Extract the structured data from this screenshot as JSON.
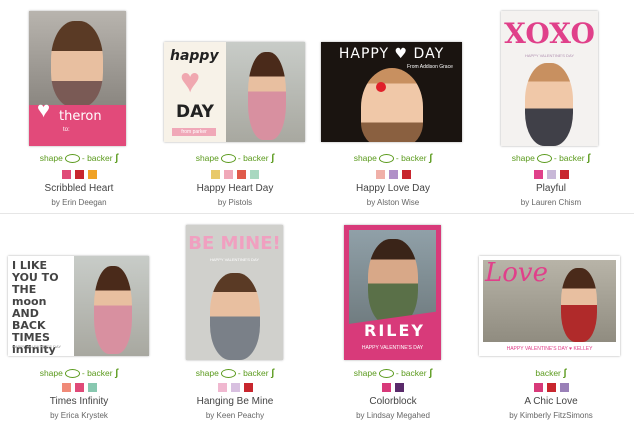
{
  "options_label": {
    "shape": "shape",
    "sep": "-",
    "backer": "backer"
  },
  "cards": [
    {
      "name": "Scribbled Heart",
      "by": "by Erin Deegan",
      "options": "shape_backer",
      "swatches": [
        "#e04a78",
        "#c8262e",
        "#f0a226"
      ],
      "card_text": "theron",
      "card_subtext": "to:"
    },
    {
      "name": "Happy Heart Day",
      "by": "by Pistols",
      "options": "shape_backer",
      "swatches": [
        "#e8c96a",
        "#f0a8b8",
        "#e05a4a",
        "#a8d8c0"
      ],
      "card_text": "happy",
      "card_text2": "DAY",
      "card_subtext": "from parker"
    },
    {
      "name": "Happy Love Day",
      "by": "by Alston Wise",
      "options": "shape_backer",
      "swatches": [
        "#f0b0a8",
        "#b090c8",
        "#c8262e"
      ],
      "card_text": "HAPPY ♥ DAY",
      "card_subtext": "From Addison Grace"
    },
    {
      "name": "Playful",
      "by": "by Lauren Chism",
      "options": "shape_backer",
      "swatches": [
        "#e0408a",
        "#c8b8d8",
        "#c8262e"
      ],
      "card_text": "XOXO",
      "card_subtext": "HAPPY VALENTINE'S DAY"
    },
    {
      "name": "Times Infinity",
      "by": "by Erica Krystek",
      "options": "shape_backer",
      "swatches": [
        "#f08a78",
        "#e04a78",
        "#88c8b0"
      ],
      "card_text": "I LIKE YOU TO THE moon AND BACK TIMES infinity",
      "card_subtext": "HAPPY VALENTINE'S DAY"
    },
    {
      "name": "Hanging Be Mine",
      "by": "by Keen Peachy",
      "options": "shape_backer",
      "swatches": [
        "#f0b8d0",
        "#d8c0e0",
        "#c8262e"
      ],
      "card_text": "BE MINE!",
      "card_subtext": "HAPPY VALENTINE'S DAY"
    },
    {
      "name": "Colorblock",
      "by": "by Lindsay Megahed",
      "options": "shape_backer",
      "swatches": [
        "#d83a7a",
        "#5a2a6a"
      ],
      "card_text": "RILEY",
      "card_subtext": "HAPPY VALENTINE'S DAY"
    },
    {
      "name": "A Chic Love",
      "by": "by Kimberly FitzSimons",
      "options": "backer",
      "swatches": [
        "#d83a7a",
        "#c8262e",
        "#9a80b8"
      ],
      "card_text": "Love",
      "card_subtext": "HAPPY VALENTINE'S DAY ♥ KELLEY"
    }
  ]
}
